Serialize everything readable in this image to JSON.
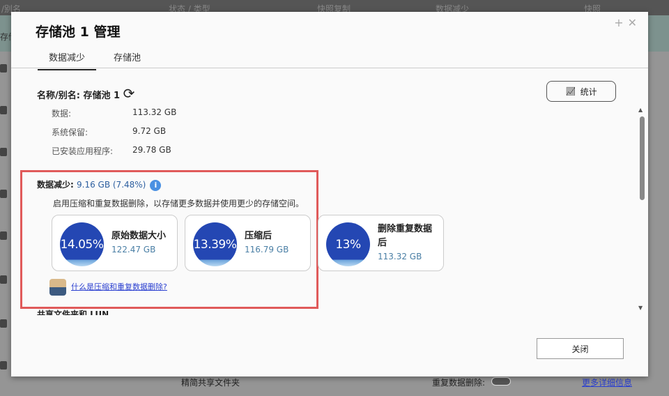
{
  "background": {
    "columns": [
      "/别名",
      "状态 / 类型",
      "快照复制",
      "数据减少",
      "快照"
    ],
    "row_label": "存储",
    "footer": {
      "shared_folder": "精简共享文件夹",
      "dedup_label": "重复数据删除:",
      "more_info": "更多详细信息"
    }
  },
  "modal": {
    "title": "存储池 1 管理",
    "tabs": [
      {
        "label": "数据减少",
        "active": true
      },
      {
        "label": "存储池",
        "active": false
      }
    ],
    "name_label": "名称/别名: 存储池 1",
    "stats_button": "统计",
    "details": [
      {
        "label": "数据:",
        "value": "113.32 GB"
      },
      {
        "label": "系统保留:",
        "value": "9.72 GB"
      },
      {
        "label": "已安装应用程序:",
        "value": "29.78 GB"
      }
    ],
    "reduction": {
      "label": "数据减少:",
      "value": "9.16 GB (7.48%)",
      "description": "启用压缩和重复数据删除，以存储更多数据并使用更少的存储空间。",
      "cards": [
        {
          "percent": "14.05%",
          "name": "原始数据大小",
          "size": "122.47 GB"
        },
        {
          "percent": "13.39%",
          "name": "压缩后",
          "size": "116.79 GB"
        },
        {
          "percent": "13%",
          "name": "删除重复数据后",
          "size": "113.32 GB"
        }
      ],
      "help_link": "什么是压缩和重复数据删除?"
    },
    "next_section": "共享文件夹和 LUN",
    "close_button": "关闭",
    "accent": "#2447b3"
  }
}
